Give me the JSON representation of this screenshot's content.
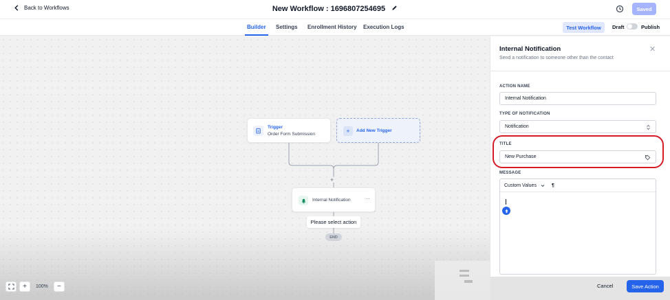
{
  "header": {
    "back_label": "Back to Workflows",
    "title": "New Workflow : 1696807254695",
    "saved_label": "Saved"
  },
  "tabs": [
    {
      "label": "Builder",
      "active": true
    },
    {
      "label": "Settings",
      "active": false
    },
    {
      "label": "Enrollment History",
      "active": false
    },
    {
      "label": "Execution Logs",
      "active": false
    }
  ],
  "toolbar": {
    "test_workflow_label": "Test Workflow",
    "draft_label": "Draft",
    "publish_label": "Publish",
    "publish_on": false
  },
  "canvas": {
    "trigger": {
      "title": "Trigger",
      "subtitle": "Order Form Submission"
    },
    "add_trigger_label": "Add New Trigger",
    "action_label": "Internal Notification",
    "select_action_tip": "Please select action",
    "end_label": "END",
    "zoom_level": "100%"
  },
  "panel": {
    "title": "Internal Notification",
    "subtitle": "Send a notification to someone other than the contact",
    "action_name_label": "ACTION NAME",
    "action_name_value": "Internal Notification",
    "type_label": "TYPE OF NOTIFICATION",
    "type_value": "Notification",
    "title_label": "TITLE",
    "title_value": "New Purchase",
    "message_label": "MESSAGE",
    "custom_values_label": "Custom Values",
    "cancel_label": "Cancel",
    "save_label": "Save Action"
  },
  "colors": {
    "accent": "#2563eb",
    "highlight": "#d41c27"
  }
}
